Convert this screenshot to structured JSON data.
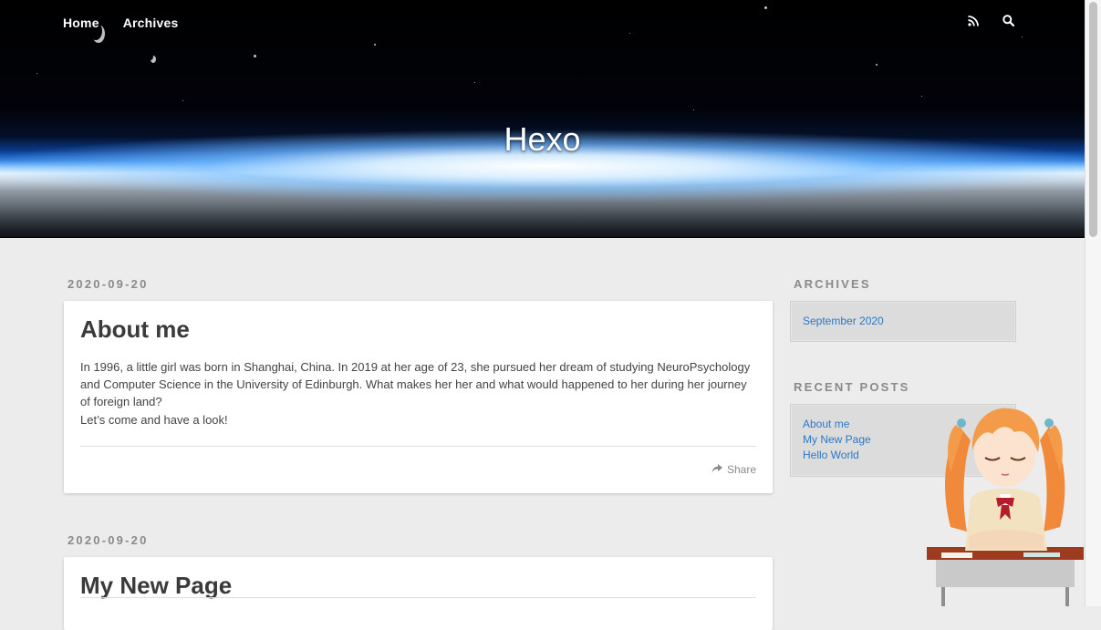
{
  "nav": {
    "items": [
      "Home",
      "Archives"
    ],
    "icons": [
      "rss-icon",
      "search-icon"
    ]
  },
  "site": {
    "title": "Hexo"
  },
  "posts": [
    {
      "date": "2020-09-20",
      "title": "About me",
      "paragraphs": [
        "In 1996, a little girl was born in Shanghai, China. In 2019 at her age of 23, she pursued her dream of studying NeuroPsychology and Computer Science in the University of Edinburgh. What makes her her and what would happened to her during her journey of foreign land?",
        "Let’s come and have a look!"
      ],
      "share_label": "Share"
    },
    {
      "date": "2020-09-20",
      "title": "My New Page"
    }
  ],
  "sidebar": {
    "archives": {
      "title": "ARCHIVES",
      "items": [
        "September 2020"
      ]
    },
    "recent_posts": {
      "title": "RECENT POSTS",
      "items": [
        "About me",
        "My New Page",
        "Hello World"
      ]
    }
  },
  "colors": {
    "link": "#2b78c5",
    "muted": "#8a8a8a",
    "title": "#3a3a3a"
  }
}
